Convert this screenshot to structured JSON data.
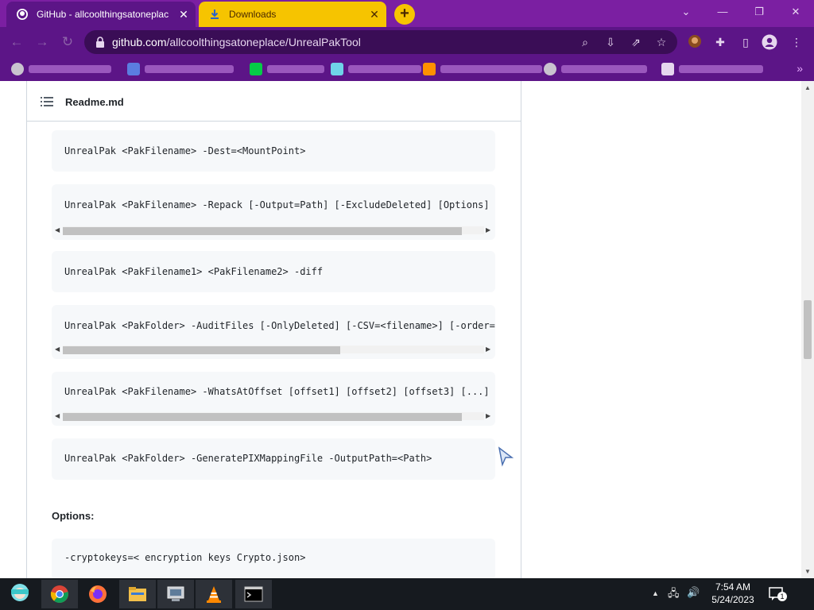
{
  "browser": {
    "tabs": [
      {
        "title": "GitHub - allcoolthingsatoneplac",
        "icon": "github-icon",
        "active": true
      },
      {
        "title": "Downloads",
        "icon": "download-icon",
        "active": false
      }
    ],
    "new_tab_label": "+",
    "url_domain": "github.com",
    "url_path": "/allcoolthingsatoneplace/UnrealPakTool",
    "colors": {
      "frame": "#7b1fa2",
      "toolbar": "#5c1587",
      "omnibox": "#3a0d56",
      "downloads_tab": "#f6c400"
    }
  },
  "bookmarks": [
    {
      "icon": "globe-icon"
    },
    {
      "icon": "blue-mark-icon"
    },
    {
      "icon": "deviantart-icon"
    },
    {
      "icon": "triangle-logo-icon"
    },
    {
      "icon": "ph-icon"
    },
    {
      "icon": "globe-icon"
    },
    {
      "icon": "stamp-icon"
    }
  ],
  "readme": {
    "title": "Readme.md",
    "code_blocks": [
      {
        "text": "UnrealPak <PakFilename> -Dest=<MountPoint>"
      },
      {
        "text": "UnrealPak <PakFilename> -Repack [-Output=Path] [-ExcludeDeleted] [Options]",
        "scroll_fraction": 0.95
      },
      {
        "text": "UnrealPak <PakFilename1> <PakFilename2> -diff"
      },
      {
        "text": "UnrealPak <PakFolder> -AuditFiles [-OnlyDeleted] [-CSV=<filename>] [-order=",
        "scroll_fraction": 0.66
      },
      {
        "text": "UnrealPak <PakFilename> -WhatsAtOffset [offset1] [offset2] [offset3] [...]",
        "scroll_fraction": 0.95
      },
      {
        "text": "UnrealPak <PakFolder> -GeneratePIXMappingFile -OutputPath=<Path>"
      }
    ],
    "options_heading": "Options:",
    "options_code": "-cryptokeys=< encryption keys Crypto.json>"
  },
  "taskbar": {
    "apps": [
      "hatsune-miku-start-icon",
      "chrome-icon",
      "firefox-icon",
      "file-explorer-icon",
      "network-app-icon",
      "vlc-icon",
      "cmd-icon"
    ],
    "time": "7:54 AM",
    "date": "5/24/2023",
    "notification_count": "1"
  }
}
